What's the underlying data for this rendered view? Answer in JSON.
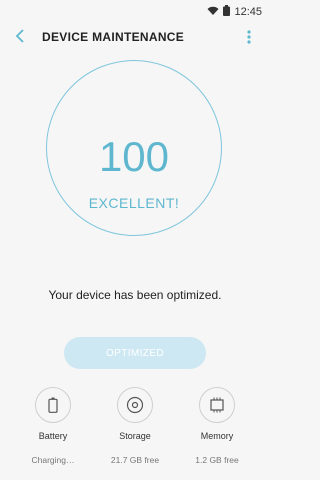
{
  "status_bar": {
    "time": "12:45"
  },
  "app_bar": {
    "title": "DEVICE MAINTENANCE"
  },
  "score": {
    "value": "100",
    "label": "EXCELLENT!"
  },
  "message": "Your device has been optimized.",
  "action_button": {
    "label": "OPTIMIZED"
  },
  "tools": [
    {
      "name": "Battery",
      "status": "Charging…"
    },
    {
      "name": "Storage",
      "status": "21.7 GB free"
    },
    {
      "name": "Memory",
      "status": "1.2 GB free"
    }
  ],
  "colors": {
    "accent": "#5eb7cf",
    "ring": "#7fc6dc",
    "button_bg": "#cde8f2",
    "background": "#f6f6f6"
  }
}
